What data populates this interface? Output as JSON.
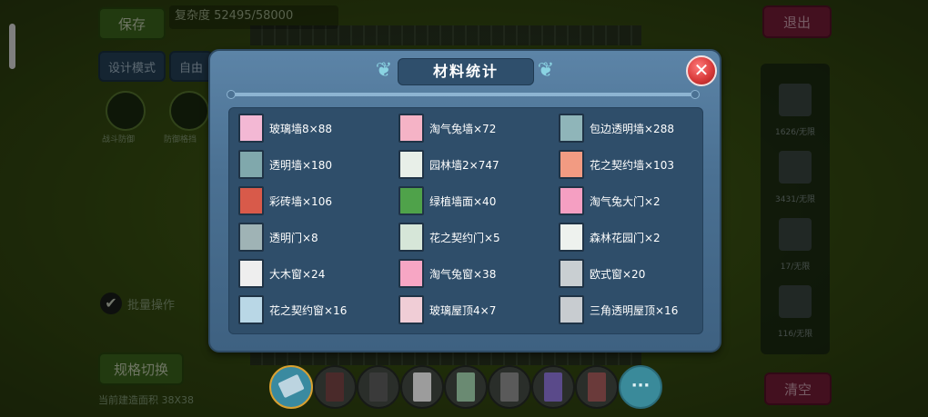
{
  "hud": {
    "save_label": "保存",
    "exit_label": "退出",
    "complexity": "复杂度 52495/58000",
    "design_mode": "设计模式",
    "free_mode": "自由",
    "avatar_1": "战斗防御",
    "avatar_2": "防御格挡",
    "check_label": "批量操作",
    "spec_switch": "规格切换",
    "area": "当前建造面积 38X38",
    "clear_label": "清空",
    "right_panel": [
      "1626/无限",
      "3431/无限",
      "17/无限",
      "116/无限"
    ],
    "more_icon": "more-icon"
  },
  "modal": {
    "title": "材料统计",
    "close": "close-icon",
    "items": [
      {
        "label": "玻璃墙8×88",
        "icon": "glass-wall-icon",
        "color": "#f3b8d4"
      },
      {
        "label": "淘气兔墙×72",
        "icon": "rabbit-wall-icon",
        "color": "#f5b3c6"
      },
      {
        "label": "包边透明墙×288",
        "icon": "edged-wall-icon",
        "color": "#8fb5b9"
      },
      {
        "label": "透明墙×180",
        "icon": "transparent-wall-icon",
        "color": "#80a8ac"
      },
      {
        "label": "园林墙2×747",
        "icon": "garden-wall-icon",
        "color": "#e8efe8"
      },
      {
        "label": "花之契约墙×103",
        "icon": "flower-wall-icon",
        "color": "#f29b82"
      },
      {
        "label": "彩砖墙×106",
        "icon": "brick-wall-icon",
        "color": "#d85a4a"
      },
      {
        "label": "绿植墙面×40",
        "icon": "plant-wall-icon",
        "color": "#4fa24a"
      },
      {
        "label": "淘气兔大门×2",
        "icon": "rabbit-gate-icon",
        "color": "#f59fc2"
      },
      {
        "label": "透明门×8",
        "icon": "transparent-door-icon",
        "color": "#9fb3b5"
      },
      {
        "label": "花之契约门×5",
        "icon": "flower-door-icon",
        "color": "#d6e6d8"
      },
      {
        "label": "森林花园门×2",
        "icon": "forest-door-icon",
        "color": "#eef2ee"
      },
      {
        "label": "大木窗×24",
        "icon": "wood-window-icon",
        "color": "#eeeeee"
      },
      {
        "label": "淘气兔窗×38",
        "icon": "rabbit-window-icon",
        "color": "#f7a6c4"
      },
      {
        "label": "欧式窗×20",
        "icon": "euro-window-icon",
        "color": "#c9cfd2"
      },
      {
        "label": "花之契约窗×16",
        "icon": "flower-window-icon",
        "color": "#b9d7e6"
      },
      {
        "label": "玻璃屋顶4×7",
        "icon": "glass-roof-icon",
        "color": "#f0cdd6"
      },
      {
        "label": "三角透明屋顶×16",
        "icon": "triangle-roof-icon",
        "color": "#c8ccd0"
      }
    ]
  },
  "hotbar": [
    {
      "icon": "eraser-icon",
      "color": "#bcd4e0"
    },
    {
      "icon": "dark-door-icon",
      "color": "#4a2a2a"
    },
    {
      "icon": "gray-door-icon",
      "color": "#3a3a3a"
    },
    {
      "icon": "white-door-icon",
      "color": "#9c9c9c"
    },
    {
      "icon": "green-door-icon",
      "color": "#6a8a72"
    },
    {
      "icon": "panel-door-icon",
      "color": "#5a5a5a"
    },
    {
      "icon": "purple-door-icon",
      "color": "#5a4a8a"
    },
    {
      "icon": "brown-door-icon",
      "color": "#6a3a3a"
    }
  ]
}
